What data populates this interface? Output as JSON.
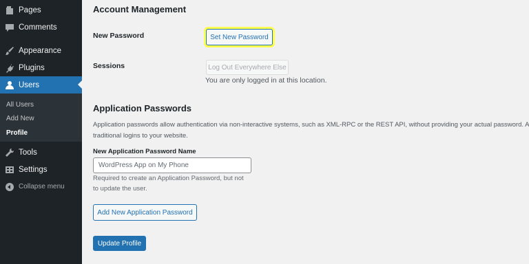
{
  "sidebar": {
    "items": [
      {
        "label": "Pages",
        "icon": "pages-icon"
      },
      {
        "label": "Comments",
        "icon": "comments-icon"
      },
      {
        "label": "Appearance",
        "icon": "appearance-icon"
      },
      {
        "label": "Plugins",
        "icon": "plugins-icon"
      },
      {
        "label": "Users",
        "icon": "users-icon",
        "current": true
      },
      {
        "label": "Tools",
        "icon": "tools-icon"
      },
      {
        "label": "Settings",
        "icon": "settings-icon"
      }
    ],
    "submenu": [
      "All Users",
      "Add New",
      "Profile"
    ],
    "collapse_label": "Collapse menu"
  },
  "account": {
    "heading": "Account Management",
    "new_password_label": "New Password",
    "set_password_button": "Set New Password",
    "sessions_label": "Sessions",
    "logout_button": "Log Out Everywhere Else",
    "sessions_note": "You are only logged in at this location."
  },
  "app_passwords": {
    "heading": "Application Passwords",
    "description_line1": "Application passwords allow authentication via non-interactive systems, such as XML-RPC or the REST API, without providing your actual password. A",
    "description_line2": "traditional logins to your website.",
    "name_label": "New Application Password Name",
    "name_placeholder": "WordPress App on My Phone",
    "help_line1": "Required to create an Application Password, but not",
    "help_line2": "to update the user.",
    "add_button": "Add New Application Password"
  },
  "update_button": "Update Profile",
  "colors": {
    "sidebar_bg": "#1d2327",
    "accent": "#2271b1",
    "highlight": "#ffff4d"
  }
}
